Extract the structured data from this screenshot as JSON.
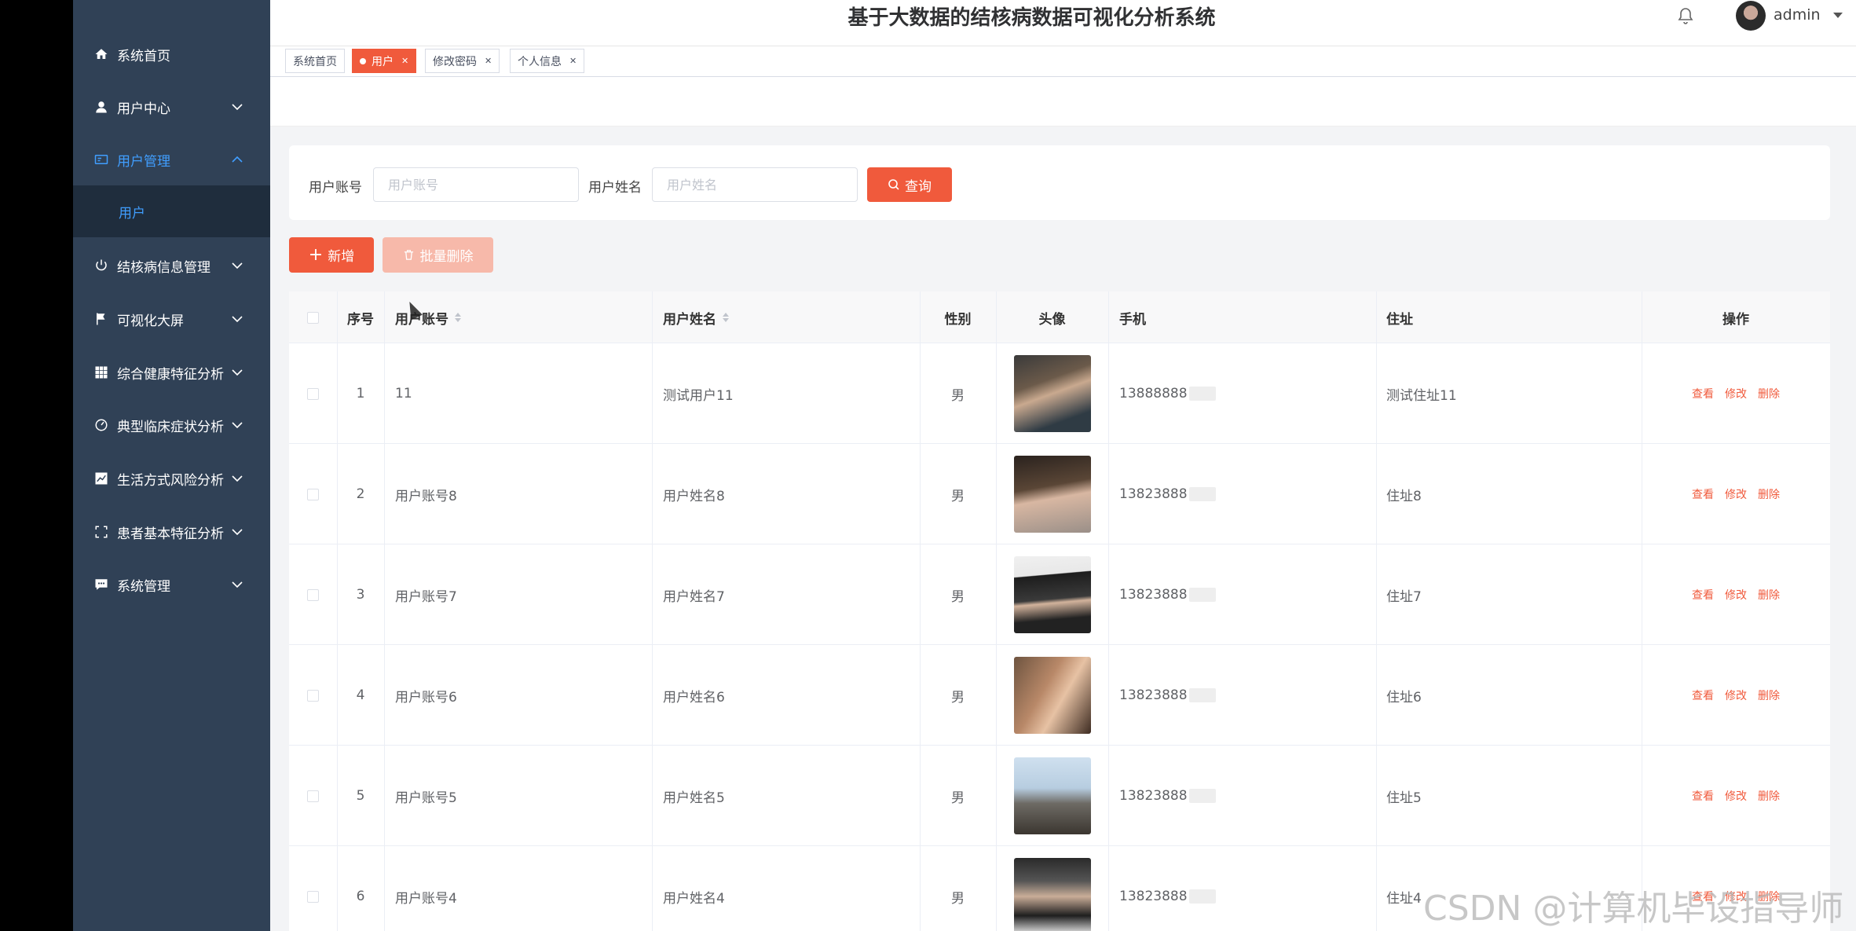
{
  "header": {
    "title": "基于大数据的结核病数据可视化分析系统",
    "username": "admin"
  },
  "sidebar": {
    "items": [
      {
        "label": "系统首页",
        "icon": "home-icon"
      },
      {
        "label": "用户中心",
        "icon": "user-icon"
      },
      {
        "label": "用户管理",
        "icon": "id-card-icon",
        "active": true,
        "expanded": true
      },
      {
        "label": "结核病信息管理",
        "icon": "power-icon"
      },
      {
        "label": "可视化大屏",
        "icon": "flag-icon"
      },
      {
        "label": "综合健康特征分析",
        "icon": "grid-icon"
      },
      {
        "label": "典型临床症状分析",
        "icon": "gauge-icon"
      },
      {
        "label": "生活方式风险分析",
        "icon": "chart-icon"
      },
      {
        "label": "患者基本特征分析",
        "icon": "fullscreen-icon"
      },
      {
        "label": "系统管理",
        "icon": "message-icon"
      }
    ],
    "subitem": "用户"
  },
  "tags": [
    {
      "label": "系统首页",
      "active": false,
      "closable": false
    },
    {
      "label": "用户",
      "active": true,
      "closable": true
    },
    {
      "label": "修改密码",
      "active": false,
      "closable": true
    },
    {
      "label": "个人信息",
      "active": false,
      "closable": true
    }
  ],
  "search": {
    "account_label": "用户账号",
    "account_placeholder": "用户账号",
    "name_label": "用户姓名",
    "name_placeholder": "用户姓名",
    "query_label": "查询"
  },
  "actions": {
    "add_label": "新增",
    "batch_delete_label": "批量删除"
  },
  "table": {
    "columns": [
      "序号",
      "用户账号",
      "用户姓名",
      "性别",
      "头像",
      "手机",
      "住址",
      "操作"
    ],
    "rows": [
      {
        "index": "1",
        "account": "11",
        "name": "测试用户11",
        "gender": "男",
        "phone": "13888888",
        "address": "测试住址11"
      },
      {
        "index": "2",
        "account": "用户账号8",
        "name": "用户姓名8",
        "gender": "男",
        "phone": "13823888",
        "address": "住址8"
      },
      {
        "index": "3",
        "account": "用户账号7",
        "name": "用户姓名7",
        "gender": "男",
        "phone": "13823888",
        "address": "住址7"
      },
      {
        "index": "4",
        "account": "用户账号6",
        "name": "用户姓名6",
        "gender": "男",
        "phone": "13823888",
        "address": "住址6"
      },
      {
        "index": "5",
        "account": "用户账号5",
        "name": "用户姓名5",
        "gender": "男",
        "phone": "13823888",
        "address": "住址5"
      },
      {
        "index": "6",
        "account": "用户账号4",
        "name": "用户姓名4",
        "gender": "男",
        "phone": "13823888",
        "address": "住址4"
      }
    ],
    "ops": {
      "view": "查看",
      "edit": "修改",
      "delete": "删除"
    }
  },
  "watermark": "CSDN @计算机毕设指导师",
  "colors": {
    "accent": "#f05a3c",
    "sidebar": "#304156",
    "active_menu": "#409eff"
  }
}
